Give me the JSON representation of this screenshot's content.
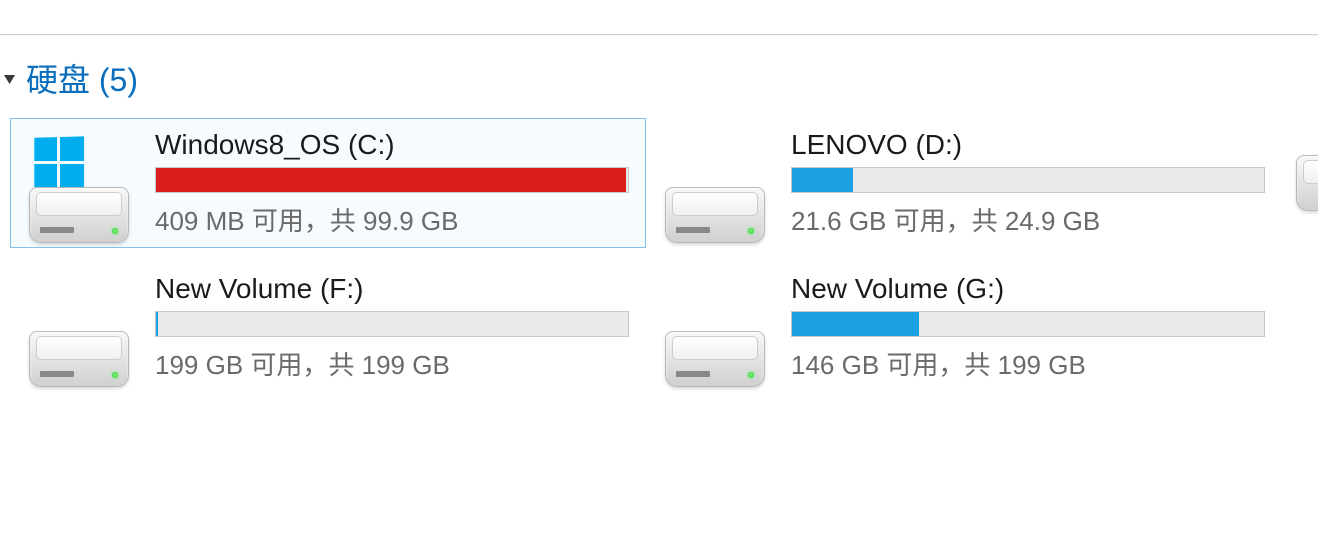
{
  "section": {
    "title": "硬盘 (5)"
  },
  "drives": [
    {
      "name": "Windows8_OS (C:)",
      "freeText": "409 MB 可用，共 99.9 GB",
      "usedPercent": 99.6,
      "critical": true,
      "osIcon": true,
      "selected": true
    },
    {
      "name": "LENOVO (D:)",
      "freeText": "21.6 GB 可用，共 24.9 GB",
      "usedPercent": 13,
      "critical": false,
      "osIcon": false,
      "selected": false
    },
    {
      "name": "New Volume (F:)",
      "freeText": "199 GB 可用，共 199 GB",
      "usedPercent": 0.4,
      "critical": false,
      "osIcon": false,
      "selected": false
    },
    {
      "name": "New Volume (G:)",
      "freeText": "146 GB 可用，共 199 GB",
      "usedPercent": 27,
      "critical": false,
      "osIcon": false,
      "selected": false
    }
  ]
}
